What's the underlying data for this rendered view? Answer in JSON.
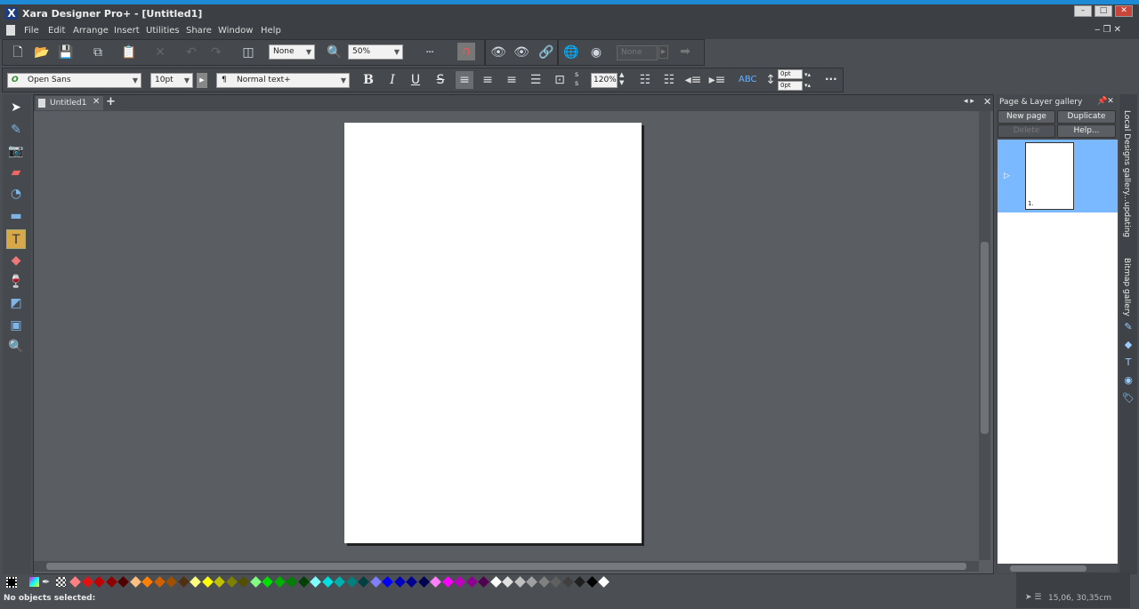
{
  "window": {
    "title": "Xara Designer Pro+ - [Untitled1]",
    "minimize": "–",
    "maximize": "□",
    "close": "✕"
  },
  "menu": [
    "File",
    "Edit",
    "Arrange",
    "Insert",
    "Utilities",
    "Share",
    "Window",
    "Help"
  ],
  "toolbar": {
    "quality": "None",
    "zoom": "50%",
    "name_field": "None"
  },
  "text_toolbar": {
    "font": "Open Sans",
    "size": "10pt",
    "style": "Normal text+",
    "line_spacing": "120%",
    "space_above": "0pt",
    "space_below": "0pt",
    "bold": "B",
    "italic": "I",
    "underline": "U",
    "strike": "S",
    "more": "···"
  },
  "document": {
    "tab": "Untitled1",
    "add_tab": "+"
  },
  "gallery": {
    "title": "Page & Layer gallery",
    "new_page": "New page",
    "duplicate": "Duplicate",
    "delete": "Delete",
    "help": "Help...",
    "page_label": "1."
  },
  "side_tabs": [
    "Local Designs gallery...updating",
    "Bitmap gallery"
  ],
  "palette": [
    "#ff8080",
    "#e81010",
    "#c00000",
    "#900000",
    "#500000",
    "#ffc080",
    "#ff8000",
    "#d06000",
    "#a05000",
    "#503010",
    "#ffff80",
    "#ffff00",
    "#c0c000",
    "#808000",
    "#505000",
    "#80ff80",
    "#00e000",
    "#00b000",
    "#008000",
    "#004000",
    "#80ffff",
    "#00e0e0",
    "#00b0b0",
    "#008080",
    "#004040",
    "#8080ff",
    "#0000ff",
    "#0000c0",
    "#000090",
    "#000050",
    "#ff80ff",
    "#ff00ff",
    "#c000c0",
    "#900090",
    "#500050",
    "#ffffff",
    "#e0e0e0",
    "#c0c0c0",
    "#a0a0a0",
    "#808080",
    "#606060",
    "#404040",
    "#202020",
    "#000000",
    "#ffffff"
  ],
  "status": {
    "message": "No objects selected:",
    "coords": "15,06, 30,35cm"
  }
}
